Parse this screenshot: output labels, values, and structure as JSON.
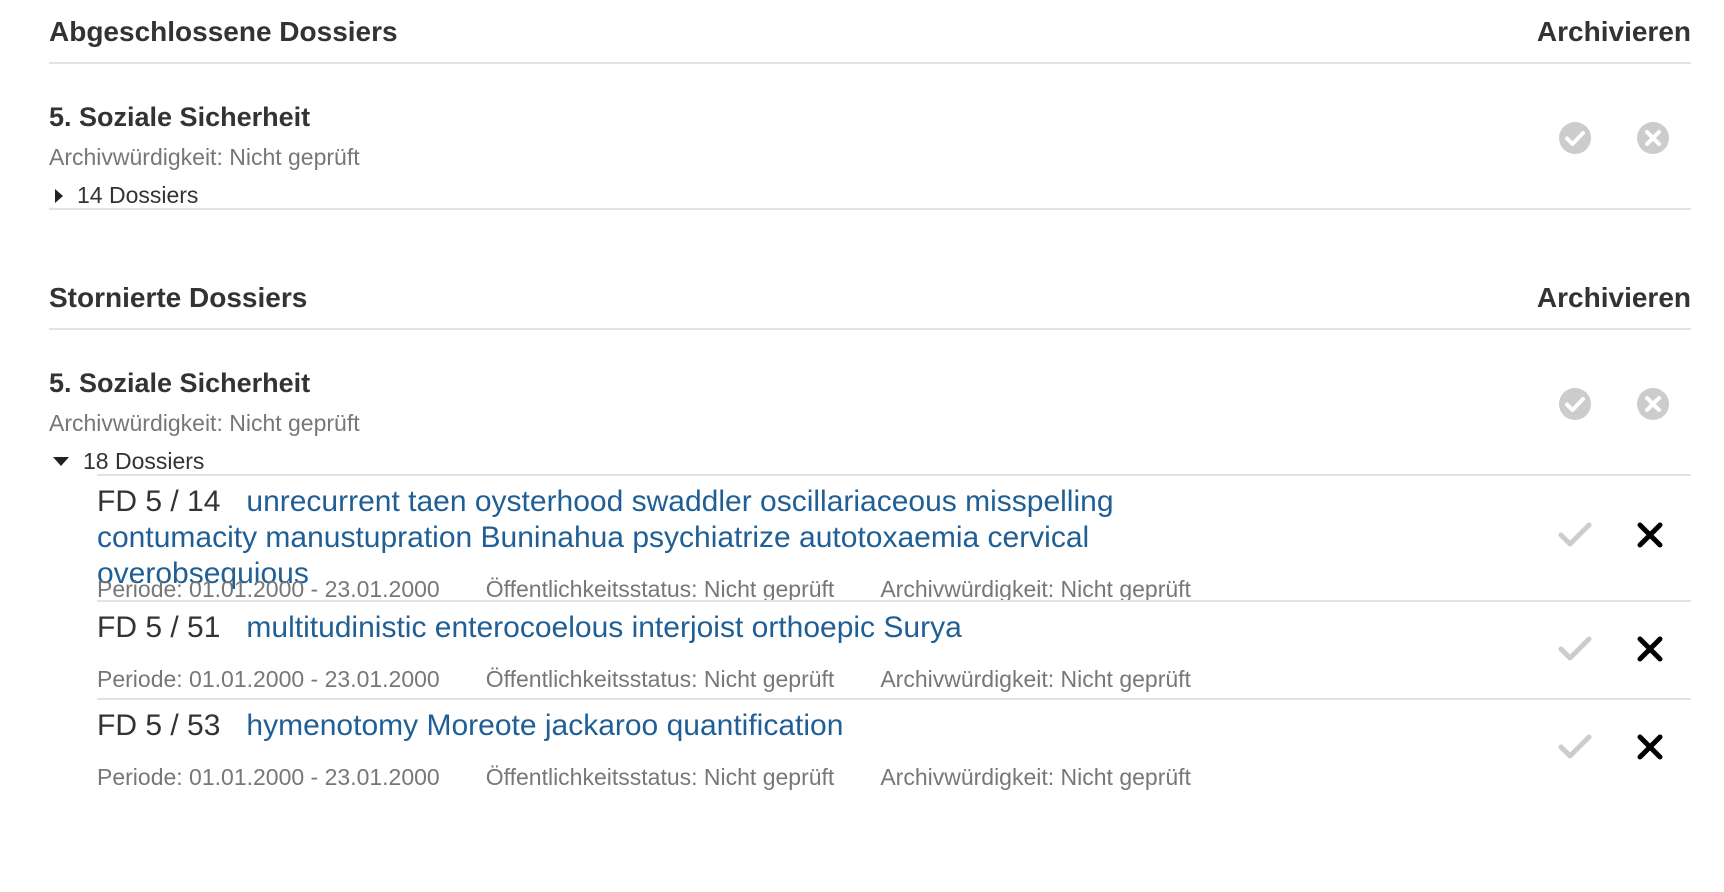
{
  "sections": [
    {
      "title": "Abgeschlossene Dossiers",
      "action": "Archivieren",
      "groups": [
        {
          "title": "5. Soziale Sicherheit",
          "archival": "Archivwürdigkeit: Nicht geprüft",
          "toggle": "14 Dossiers",
          "expanded": false
        }
      ]
    },
    {
      "title": "Stornierte Dossiers",
      "action": "Archivieren",
      "groups": [
        {
          "title": "5. Soziale Sicherheit",
          "archival": "Archivwürdigkeit: Nicht geprüft",
          "toggle": "18 Dossiers",
          "expanded": true,
          "items": [
            {
              "ref": "FD 5 / 14",
              "title": "unrecurrent taen oysterhood swaddler oscillariaceous misspelling contumacity manustupration Buninahua psychiatrize autotoxaemia cervical overobsequious",
              "period": "Periode: 01.01.2000 - 23.01.2000",
              "public": "Öffentlichkeitsstatus: Nicht geprüft",
              "archival": "Archivwürdigkeit: Nicht geprüft"
            },
            {
              "ref": "FD 5 / 51",
              "title": "multitudinistic enterocoelous interjoist orthoepic Surya",
              "period": "Periode: 01.01.2000 - 23.01.2000",
              "public": "Öffentlichkeitsstatus: Nicht geprüft",
              "archival": "Archivwürdigkeit: Nicht geprüft"
            },
            {
              "ref": "FD 5 / 53",
              "title": "hymenotomy Moreote jackaroo quantification",
              "period": "Periode: 01.01.2000 - 23.01.2000",
              "public": "Öffentlichkeitsstatus: Nicht geprüft",
              "archival": "Archivwürdigkeit: Nicht geprüft"
            }
          ]
        }
      ]
    }
  ],
  "colors": {
    "link": "#1f5f95",
    "muted": "#777777",
    "icon_disabled": "#cccccc",
    "border": "#e3e3e3"
  }
}
